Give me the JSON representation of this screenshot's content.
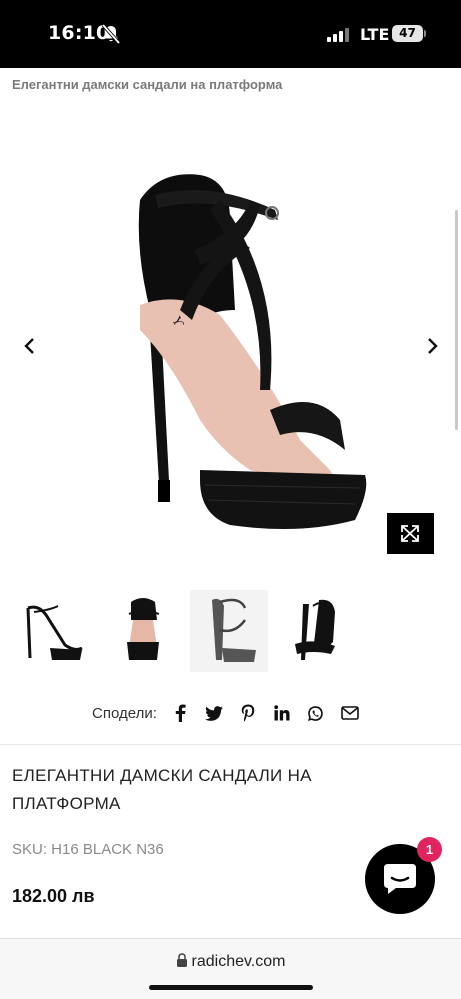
{
  "status_bar": {
    "time": "16:10",
    "network": "LTE",
    "battery": "47",
    "icons": [
      "bell-slash-icon",
      "signal-icon",
      "battery-icon"
    ]
  },
  "header": {
    "title": "Елегантни дамски сандали на платформа"
  },
  "gallery": {
    "prev_icon": "chevron-left-icon",
    "next_icon": "chevron-right-icon",
    "expand_icon": "expand-icon"
  },
  "share": {
    "label": "Сподели:",
    "icons": [
      "facebook-icon",
      "twitter-icon",
      "pinterest-icon",
      "linkedin-icon",
      "whatsapp-icon",
      "email-icon"
    ]
  },
  "product": {
    "title": "ЕЛЕГАНТНИ ДАМСКИ САНДАЛИ НА ПЛАТФОРМА",
    "sku": "SKU: H16 BLACK N36",
    "price": "182.00 лв"
  },
  "chat": {
    "badge": "1",
    "icon": "chat-icon"
  },
  "browser": {
    "url": "radichev.com",
    "lock_icon": "lock-icon"
  },
  "colors": {
    "status_bg": "#000000",
    "accent_badge": "#e0245e",
    "text_primary": "#222222",
    "text_muted": "#8a8a8a"
  }
}
